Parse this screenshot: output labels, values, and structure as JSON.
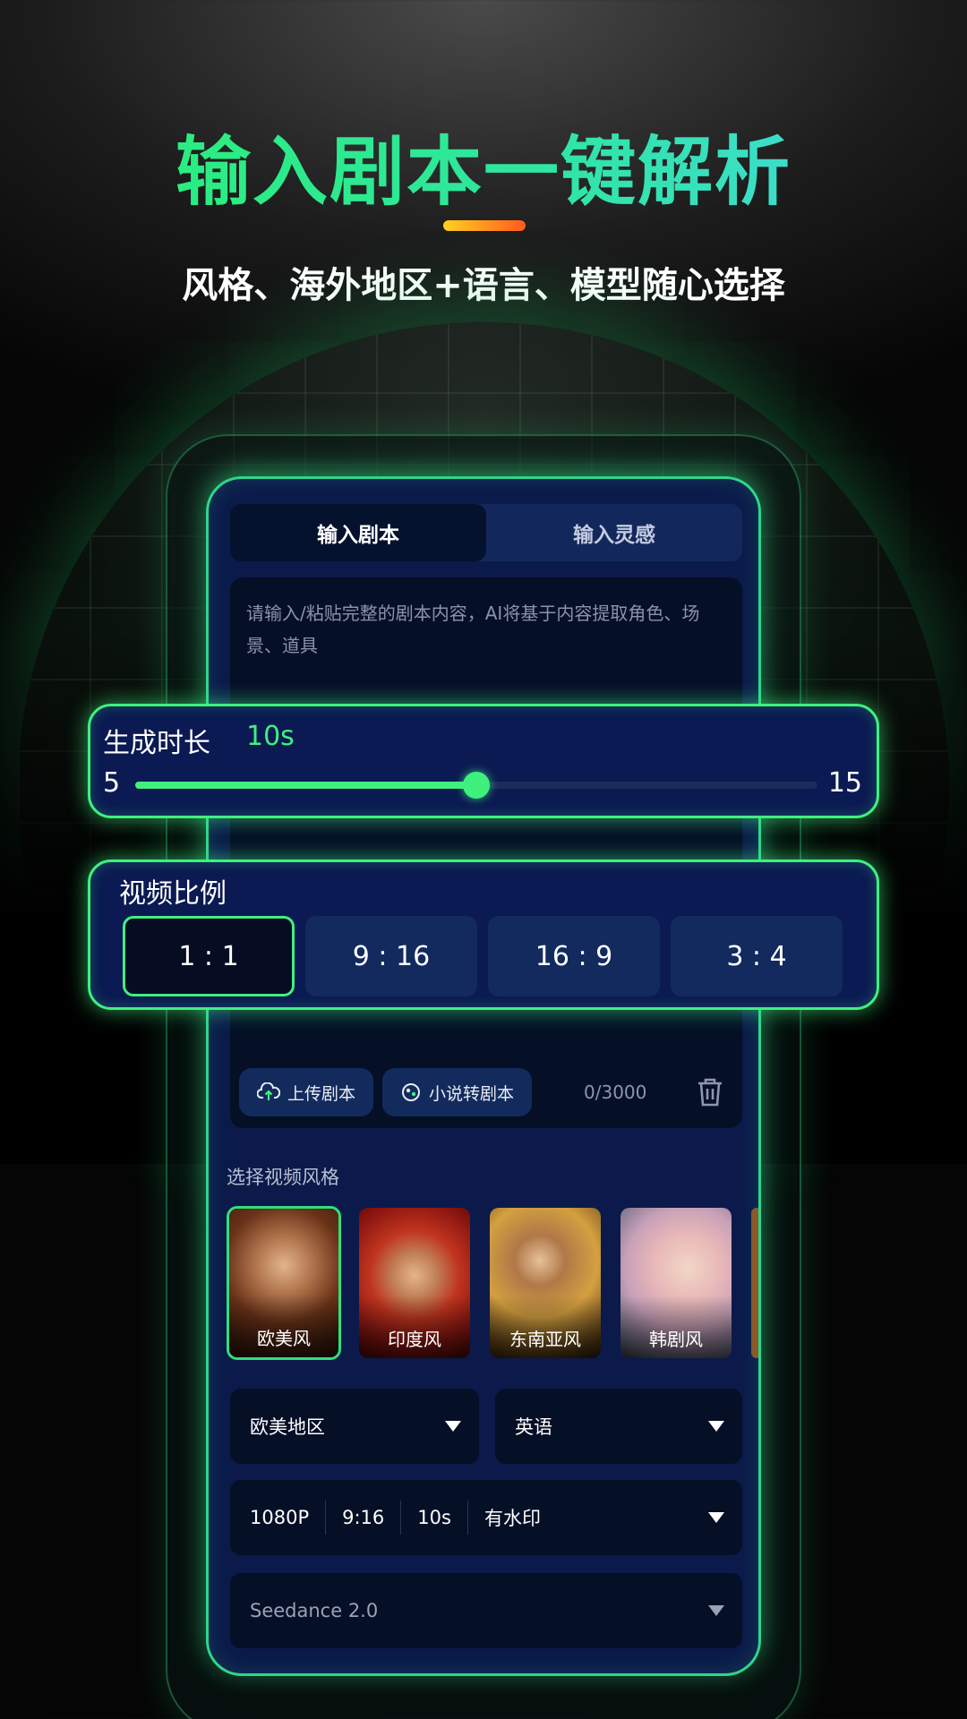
{
  "hero": {
    "title": "输入剧本一键解析",
    "subtitle": "风格、海外地区+语言、模型随心选择"
  },
  "tabs": [
    {
      "label": "输入剧本",
      "active": true
    },
    {
      "label": "输入灵感",
      "active": false
    }
  ],
  "script": {
    "placeholder": "请输入/粘贴完整的剧本内容，AI将基于内容提取角色、场景、道具",
    "upload_label": "上传剧本",
    "novel_label": "小说转剧本",
    "counter": "0/3000"
  },
  "duration": {
    "label": "生成时长",
    "value_text": "10s",
    "min": "5",
    "max": "15",
    "value": 10
  },
  "ratio": {
    "label": "视频比例",
    "options": [
      "1 : 1",
      "9 : 16",
      "16 : 9",
      "3 : 4"
    ],
    "selected": "1 : 1"
  },
  "styles": {
    "label": "选择视频风格",
    "items": [
      {
        "name": "欧美风",
        "selected": true
      },
      {
        "name": "印度风",
        "selected": false
      },
      {
        "name": "东南亚风",
        "selected": false
      },
      {
        "name": "韩剧风",
        "selected": false
      }
    ]
  },
  "region": {
    "value": "欧美地区"
  },
  "language": {
    "value": "英语"
  },
  "specs": {
    "resolution": "1080P",
    "ratio": "9:16",
    "duration": "10s",
    "watermark": "有水印"
  },
  "model": {
    "value": "Seedance 2.0"
  },
  "icons": {
    "upload": "cloud-upload-icon",
    "novel": "book-convert-icon",
    "trash": "trash-icon",
    "caret": "caret-down-icon"
  },
  "colors": {
    "accent": "#3ff07f",
    "screen_bg": "#0b1a4a",
    "title_gradient_start": "#29f071",
    "title_gradient_end": "#43d8e6",
    "underline_start": "#ffd21e",
    "underline_end": "#ff5a1e"
  }
}
